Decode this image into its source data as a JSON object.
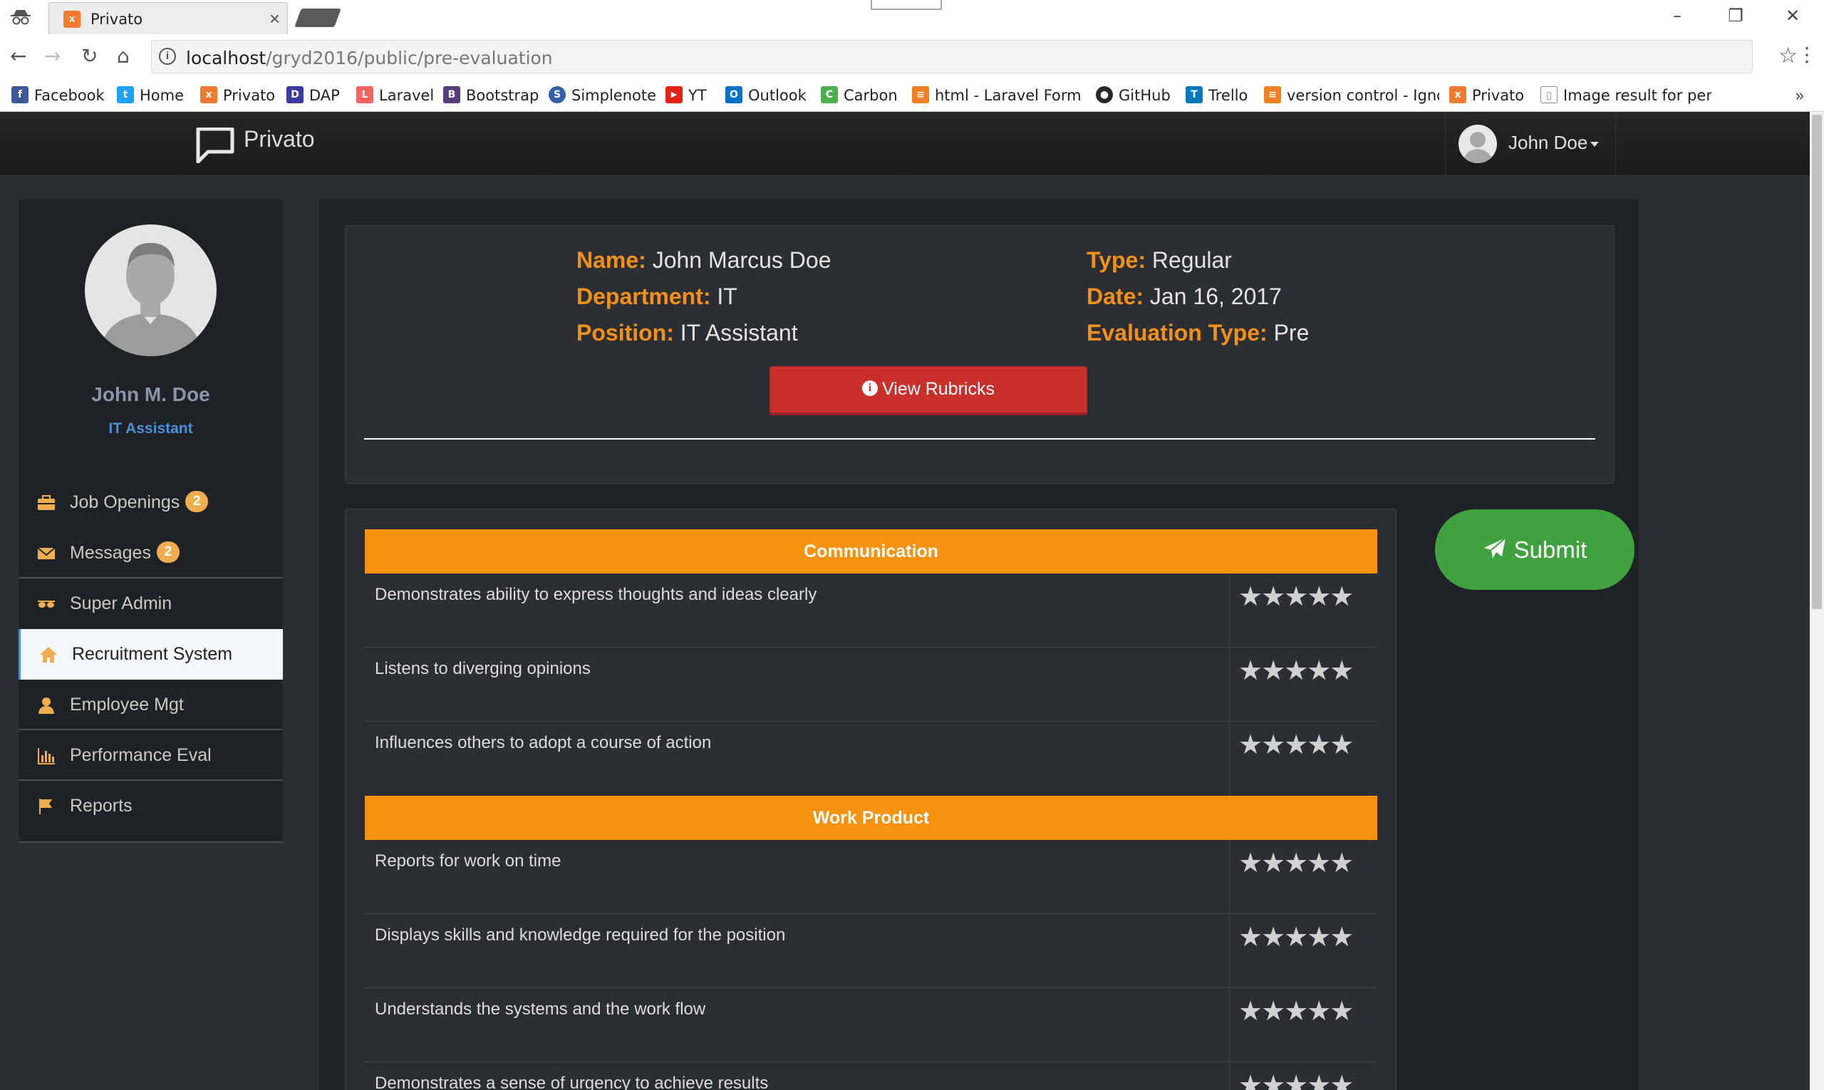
{
  "browser": {
    "tab_title": "Privato",
    "tab_close": "×",
    "url_host": "localhost",
    "url_path": "/gryd2016/public/pre-evaluation",
    "more_bookmarks": "»",
    "bookmarks": [
      {
        "label": "Facebook",
        "icon": "facebook-icon",
        "color": "#3b5998",
        "glyph": "f"
      },
      {
        "label": "Home",
        "icon": "twitter-icon",
        "color": "#1da1f2",
        "glyph": "t"
      },
      {
        "label": "Privato",
        "icon": "xampp-icon",
        "color": "#f07a2e",
        "glyph": "x"
      },
      {
        "label": "DAP",
        "icon": "dap-icon",
        "color": "#3a3aa0",
        "glyph": "D"
      },
      {
        "label": "Laravel",
        "icon": "laravel-icon",
        "color": "#f4645f",
        "glyph": "L"
      },
      {
        "label": "Bootstrap",
        "icon": "bootstrap-icon",
        "color": "#563d7c",
        "glyph": "B"
      },
      {
        "label": "Simplenote",
        "icon": "simplenote-icon",
        "color": "#3360a8",
        "glyph": "S"
      },
      {
        "label": "YT",
        "icon": "youtube-icon",
        "color": "#e62117",
        "glyph": "▶"
      },
      {
        "label": "Outlook",
        "icon": "outlook-icon",
        "color": "#0072c6",
        "glyph": "O"
      },
      {
        "label": "Carbon",
        "icon": "carbon-icon",
        "color": "#4caf50",
        "glyph": "C"
      },
      {
        "label": "html - Laravel Form b",
        "icon": "stackoverflow-icon",
        "color": "#f48024",
        "glyph": "≡"
      },
      {
        "label": "GitHub",
        "icon": "github-icon",
        "color": "#24292e",
        "glyph": "●"
      },
      {
        "label": "Trello",
        "icon": "trello-icon",
        "color": "#0079bf",
        "glyph": "T"
      },
      {
        "label": "version control - Igno",
        "icon": "stackoverflow-icon",
        "color": "#f48024",
        "glyph": "≡"
      },
      {
        "label": "Privato",
        "icon": "xampp-icon",
        "color": "#f07a2e",
        "glyph": "x"
      },
      {
        "label": "Image result for perfo",
        "icon": "page-icon",
        "color": "#888888",
        "glyph": "▯"
      }
    ]
  },
  "navbar": {
    "brand": "Privato",
    "user_name": "John Doe"
  },
  "sidebar": {
    "name": "John M. Doe",
    "position": "IT Assistant",
    "items": [
      {
        "label": "Job Openings",
        "badge": "2",
        "icon": "briefcase-icon"
      },
      {
        "label": "Messages",
        "badge": "2",
        "icon": "envelope-icon"
      },
      {
        "label": "Super Admin",
        "icon": "sunglasses-icon"
      },
      {
        "label": "Recruitment System",
        "icon": "home-icon",
        "active": true
      },
      {
        "label": "Employee Mgt",
        "icon": "user-icon"
      },
      {
        "label": "Performance Eval",
        "icon": "bar-chart-icon"
      },
      {
        "label": "Reports",
        "icon": "flag-icon"
      }
    ]
  },
  "employee": {
    "name_label": "Name:",
    "name": "John Marcus Doe",
    "department_label": "Department:",
    "department": "IT",
    "position_label": "Position:",
    "position": "IT Assistant",
    "type_label": "Type:",
    "type": "Regular",
    "date_label": "Date:",
    "date": "Jan 16, 2017",
    "eval_type_label": "Evaluation Type:",
    "eval_type": "Pre"
  },
  "actions": {
    "view_rubrics": "View Rubricks",
    "submit": "Submit"
  },
  "evaluation": {
    "sections": [
      {
        "title": "Communication",
        "criteria": [
          "Demonstrates ability to express thoughts and ideas clearly",
          "Listens to diverging opinions",
          "Influences others to adopt a course of action"
        ]
      },
      {
        "title": "Work Product",
        "criteria": [
          "Reports for work on time",
          "Displays skills and knowledge required for the position",
          "Understands the systems and the work flow",
          "Demonstrates a sense of urgency to achieve results"
        ]
      }
    ],
    "star_glyphs": "★★★★★"
  },
  "colors": {
    "accent_orange": "#f7920f",
    "danger_red": "#c9302c",
    "success_green": "#3fa23f",
    "link_blue": "#4a90d9"
  }
}
